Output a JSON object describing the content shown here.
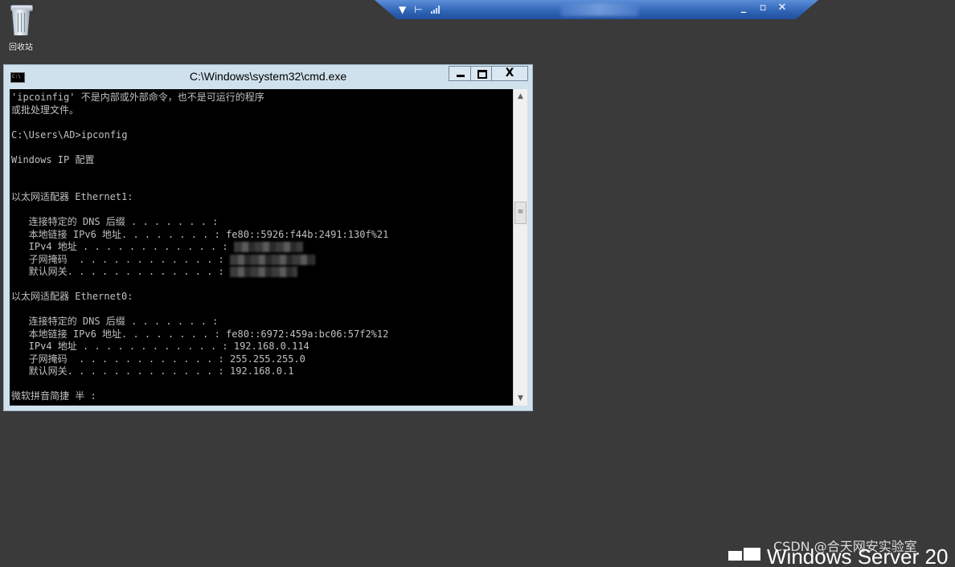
{
  "desktop": {
    "recycle_bin_label": "回收站"
  },
  "rdp_bar": {
    "left_icons": [
      "pin-icon",
      "signal-icon"
    ],
    "buttons": [
      "minimize",
      "restore",
      "close"
    ],
    "close_glyph": "✕",
    "minimize_glyph": "_",
    "restore_glyph": "▫"
  },
  "cmd_window": {
    "title": "C:\\Windows\\system32\\cmd.exe",
    "close_glyph": "X",
    "lines": {
      "l1": "'ipcoinfig' 不是内部或外部命令，也不是可运行的程序",
      "l2": "或批处理文件。",
      "l3": "",
      "l4": "C:\\Users\\AD>ipconfig",
      "l5": "",
      "l6": "Windows IP 配置",
      "l7": "",
      "l8": "",
      "l9": "以太网适配器 Ethernet1:",
      "l10": "",
      "l11": "   连接特定的 DNS 后缀 . . . . . . . :",
      "l12": "   本地链接 IPv6 地址. . . . . . . . : fe80::5926:f44b:2491:130f%21",
      "l13": "   IPv4 地址 . . . . . . . . . . . . : ",
      "l14": "   子网掩码  . . . . . . . . . . . . : ",
      "l15": "   默认网关. . . . . . . . . . . . . : ",
      "l16": "",
      "l17": "以太网适配器 Ethernet0:",
      "l18": "",
      "l19": "   连接特定的 DNS 后缀 . . . . . . . :",
      "l20": "   本地链接 IPv6 地址. . . . . . . . : fe80::6972:459a:bc06:57f2%12",
      "l21": "   IPv4 地址 . . . . . . . . . . . . : 192.168.0.114",
      "l22": "   子网掩码  . . . . . . . . . . . . : 255.255.255.0",
      "l23": "   默认网关. . . . . . . . . . . . . : 192.168.0.1",
      "l24": "",
      "l25": "微软拼音简捷 半 :"
    }
  },
  "watermark": {
    "csdn": "CSDN @合天网安实验室",
    "brand": "Windows Server 20"
  }
}
